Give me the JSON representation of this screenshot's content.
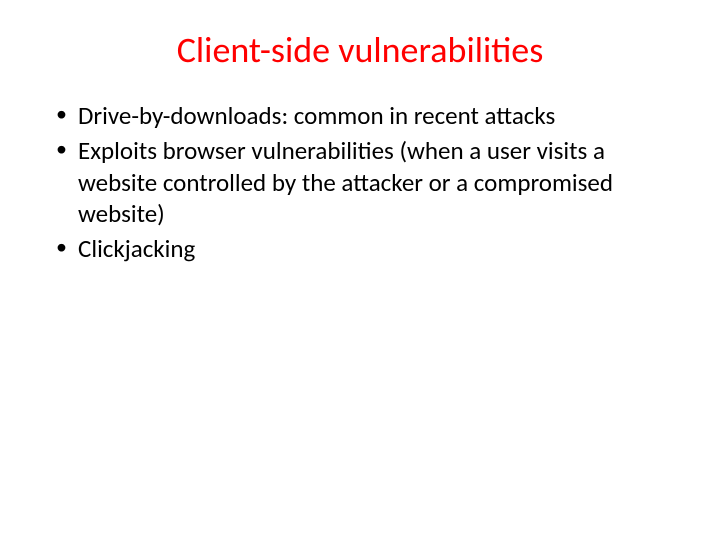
{
  "slide": {
    "title": "Client-side vulnerabilities",
    "bullets": [
      "Drive-by-downloads: common in recent attacks",
      "Exploits browser vulnerabilities (when a user visits a website controlled by the attacker or a compromised website)",
      "Clickjacking"
    ]
  }
}
